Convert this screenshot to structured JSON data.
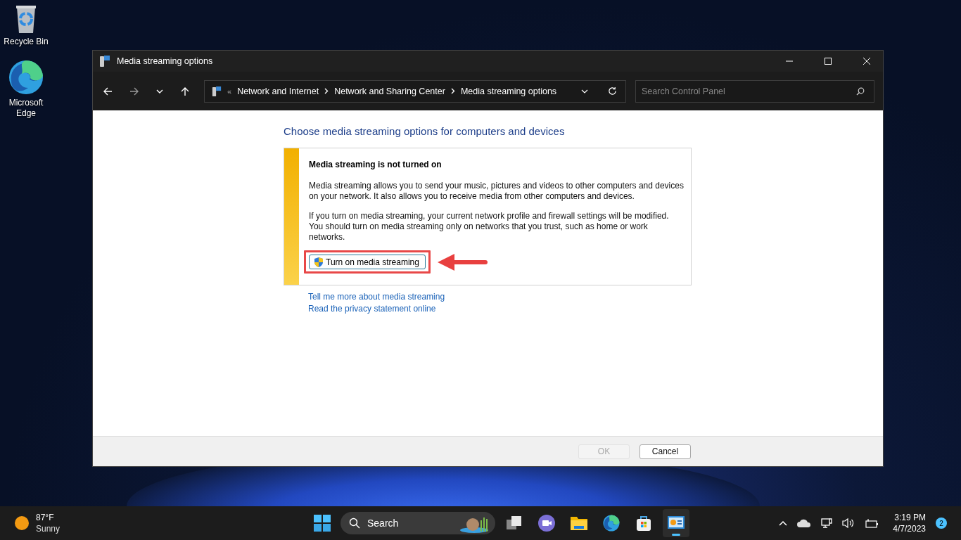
{
  "desktop_icons": [
    {
      "kind": "recycle",
      "label": "Recycle Bin"
    },
    {
      "kind": "edge",
      "label": "Microsoft Edge"
    }
  ],
  "window": {
    "title": "Media streaming options",
    "address": {
      "overflow": "«",
      "crumbs": [
        "Network and Internet",
        "Network and Sharing Center",
        "Media streaming options"
      ]
    },
    "search": {
      "placeholder": "Search Control Panel"
    },
    "heading": "Choose media streaming options for computers and devices",
    "notice": {
      "title": "Media streaming is not turned on",
      "paragraphs": [
        "Media streaming allows you to send your music, pictures and videos to other computers and devices on your network.  It also allows you to receive media from other computers and devices.",
        "If you turn on media streaming, your current network profile and firewall settings will be modified. You should turn on media streaming only on networks that you trust, such as home or work networks."
      ],
      "button": "Turn on media streaming"
    },
    "links": [
      "Tell me more about media streaming",
      "Read the privacy statement online"
    ],
    "buttons": [
      {
        "label": "OK",
        "disabled": true
      },
      {
        "label": "Cancel",
        "disabled": false
      }
    ]
  },
  "taskbar": {
    "weather": {
      "temperature": "87°F",
      "condition": "Sunny"
    },
    "search": {
      "placeholder": "Search"
    },
    "apps": [
      {
        "kind": "taskview",
        "selected": false
      },
      {
        "kind": "chat",
        "selected": false
      },
      {
        "kind": "explorer",
        "selected": false
      },
      {
        "kind": "edge",
        "selected": false
      },
      {
        "kind": "store",
        "selected": false
      },
      {
        "kind": "controlpanel",
        "selected": true
      }
    ],
    "time": "3:19 PM",
    "date": "4/7/2023",
    "notifications": "2"
  }
}
